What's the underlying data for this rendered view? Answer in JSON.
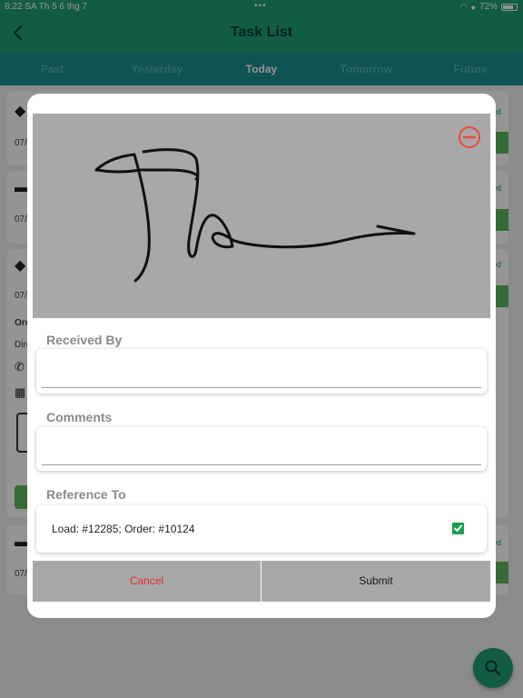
{
  "status_bar": {
    "time_date": "8:22 SA   Th 5 6 thg 7",
    "dots": "•••",
    "battery": "72%",
    "wifi_icon": "wifi-icon",
    "lock_icon": "lock-icon"
  },
  "header": {
    "title": "Task List",
    "back_icon": "chevron-left-icon"
  },
  "tabs": [
    {
      "label": "Past"
    },
    {
      "label": "Yesterday"
    },
    {
      "label": "Today"
    },
    {
      "label": "Tomorrow"
    },
    {
      "label": "Future"
    }
  ],
  "active_tab": "Today",
  "background_list": {
    "dates": [
      "07/",
      "07/",
      "07/",
      "07/"
    ],
    "status_fragments": [
      "ed",
      "ed",
      "ed",
      "ed"
    ],
    "order_fragment": "Ord",
    "direction_fragment": "Dire"
  },
  "modal": {
    "received_by": {
      "label": "Received By",
      "value": "",
      "placeholder": ""
    },
    "comments": {
      "label": "Comments",
      "value": "",
      "placeholder": ""
    },
    "reference": {
      "label": "Reference To",
      "item_text": "Load: #12285; Order: #10124",
      "checked": true
    },
    "cancel_label": "Cancel",
    "submit_label": "Submit"
  },
  "colors": {
    "brand": "#1f9d77",
    "tab_bar": "#1b8f8f",
    "cancel": "#e02d2d",
    "clear_icon": "#e84b3c",
    "checkbox": "#1f9d4f"
  }
}
